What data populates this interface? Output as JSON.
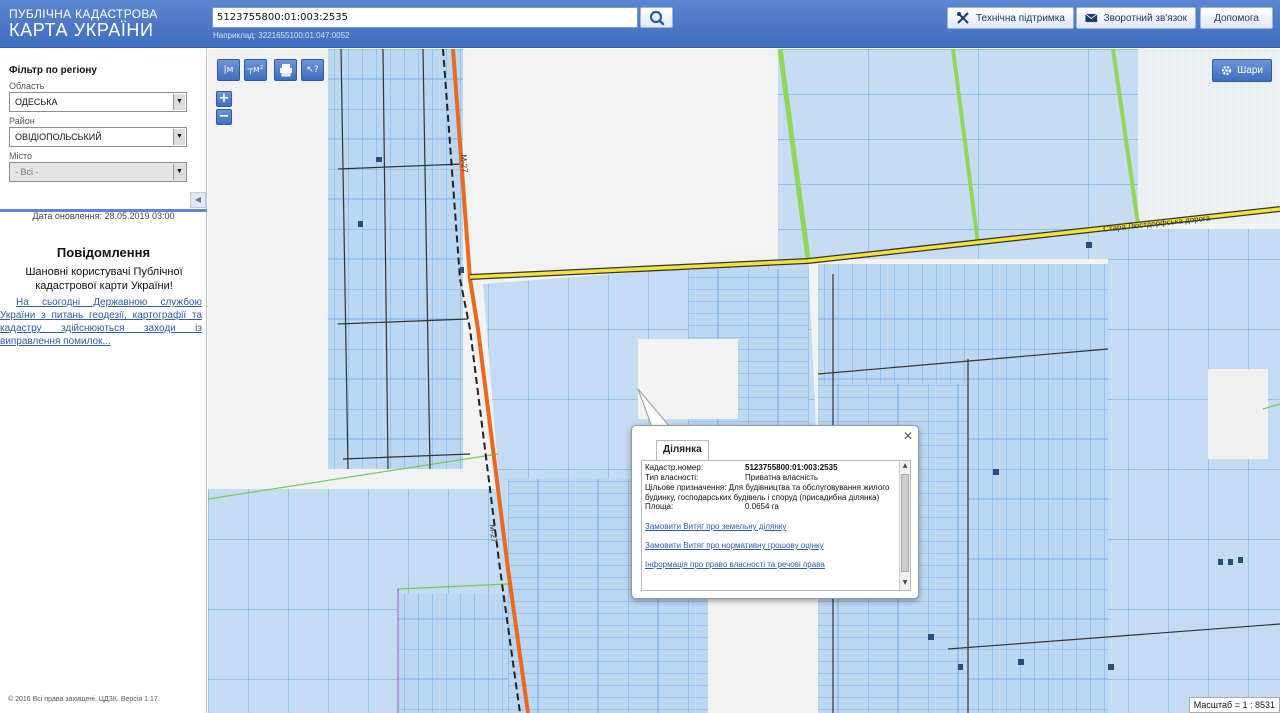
{
  "header": {
    "logo_line1": "ПУБЛІЧНА КАДАСТРОВА",
    "logo_line2": "КАРТА УКРАЇНИ",
    "search_value": "5123755800:01:003:2535",
    "search_hint": "Наприклад: 3221655100:01:047:0052",
    "support_label": "Технічна підтримка",
    "feedback_label": "Зворотний зв'язок",
    "help_label": "Допомога"
  },
  "sidebar": {
    "filter_title": "Фільтр по регіону",
    "region_label": "Область",
    "region_value": "ОДЕСЬКА",
    "district_label": "Район",
    "district_value": "ОВІДІОПОЛЬСЬКИЙ",
    "city_label": "Місто",
    "city_value": "- Всі -",
    "update_date": "Дата оновлення: 28.05.2019 03:00",
    "news_title": "Повідомлення",
    "news_lead": "Шановні користувачі Публічної кадастрової карти України!",
    "news_link": "На сьогодні Державною службою України з питань геодезії, картографії та кадастру здійснюються заходи із виправлення помилок...",
    "copyright": "© 2016 Всі права захищені. ЦДЗК. Версія 1.17."
  },
  "map": {
    "tool_measure_label": "м",
    "tool_area_label": "м²",
    "layers_label": "Шари",
    "zoom_in": "+",
    "zoom_out": "−",
    "road_label_m27": "М-27",
    "road_label_old": "Стара Люстдорфська дорога",
    "scale_text": "Масштаб = 1 : 8531"
  },
  "popup": {
    "tab_label": "Ділянка",
    "cadastral_key": "Кадастр.номер:",
    "cadastral_value": "5123755800:01:003:2535",
    "ownership_key": "Тип власності:",
    "ownership_value": "Приватна власність",
    "purpose_key": "Цільове призначення:",
    "purpose_value": "Для будівництва та обслуговування жилого будинку, господарських будівель і споруд (присадибна ділянка)",
    "area_key": "Площа:",
    "area_value": "0.0654 га",
    "link_extract": "Замовити Витяг про земельну ділянку",
    "link_valuation": "Замовити Витяг про нормативну грошову оцінку",
    "link_rights": "Інформація про право власності та речові права"
  },
  "colors": {
    "header_blue": "#4a76c7",
    "parcel_fill": "#b9d5f1",
    "parcel_stroke": "#5ea4e6",
    "road_orange": "#e96a1f",
    "road_yellow": "#f3e23a",
    "border_green": "#8fd85a"
  }
}
